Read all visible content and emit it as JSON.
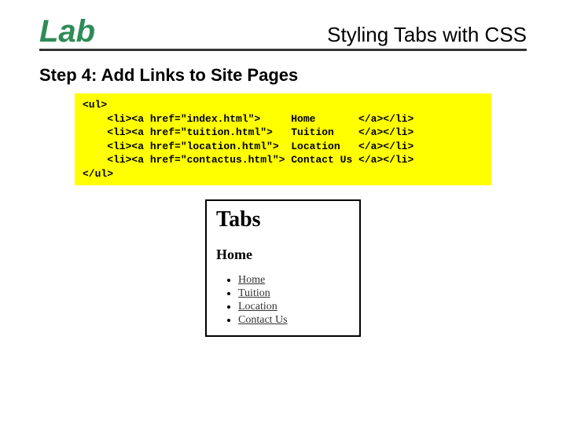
{
  "header": {
    "lab": "Lab",
    "title": "Styling Tabs with CSS"
  },
  "step": {
    "label": "Step 4:  Add Links to Site Pages"
  },
  "code": {
    "lines": [
      "<ul>",
      "    <li><a href=\"index.html\">     Home       </a></li>",
      "    <li><a href=\"tuition.html\">   Tuition    </a></li>",
      "    <li><a href=\"location.html\">  Location   </a></li>",
      "    <li><a href=\"contactus.html\"> Contact Us </a></li>",
      "</ul>"
    ]
  },
  "preview": {
    "heading": "Tabs",
    "subheading": "Home",
    "links": [
      "Home",
      "Tuition",
      "Location",
      "Contact Us"
    ]
  }
}
